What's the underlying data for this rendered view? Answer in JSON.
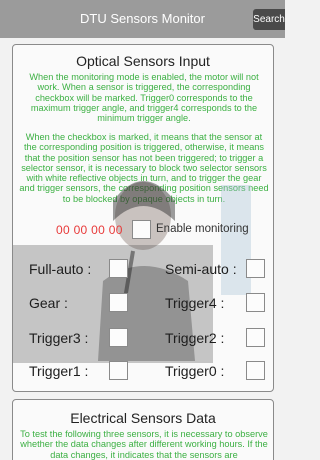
{
  "appbar": {
    "title": "DTU Sensors Monitor",
    "search_label": "Search"
  },
  "optical": {
    "title": "Optical Sensors Input",
    "paragraph1": "When the monitoring mode is enabled, the motor will not work. When a sensor is triggered, the corresponding checkbox will be marked. Trigger0 corresponds to the maximum trigger angle, and trigger4 corresponds to the minimum trigger angle.",
    "paragraph2": "When the checkbox is marked, it means that the sensor at the corresponding position is triggered, otherwise, it means that the position sensor has not been triggered; to trigger a selector sensor, it is necessary to block two selector sensors with white reflective objects in turn, and to trigger the gear and trigger sensors, the corresponding position sensors need to be blocked by opaque objects in turn.",
    "counter": "00 00 00 00",
    "enable_label": "Enable monitoring",
    "rows": [
      {
        "left": "Full-auto :",
        "right": "Semi-auto :"
      },
      {
        "left": "Gear :",
        "right": "Trigger4 :"
      },
      {
        "left": "Trigger3 :",
        "right": "Trigger2 :"
      },
      {
        "left": "Trigger1 :",
        "right": "Trigger0 :"
      }
    ]
  },
  "electrical": {
    "title": "Electrical Sensors Data",
    "paragraph": "To test the following three sensors, it is necessary to observe whether the data changes after different working hours. If the data changes, it indicates that the sensors are"
  },
  "colors": {
    "appbar": "#9b9b9b",
    "accent_text": "#3cb043",
    "counter": "#e83a3a"
  }
}
